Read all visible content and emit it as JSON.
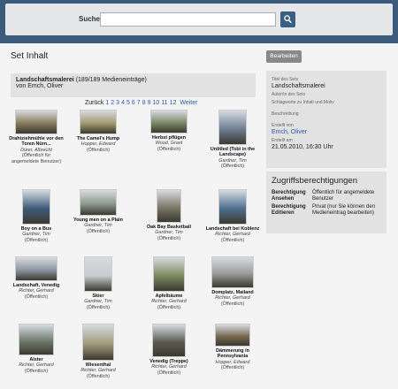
{
  "header": {
    "search_label": "Suche",
    "search_placeholder": "",
    "search_value": ""
  },
  "page": {
    "title": "Set Inhalt",
    "edit_label": "Bearbeiten"
  },
  "set": {
    "name": "Landschaftsmalerei",
    "count": "(189/189 Medieneinträge)",
    "owner_line": "von Emch, Oliver"
  },
  "pager": {
    "back": "Zurück",
    "pages": [
      "1",
      "2",
      "3",
      "4",
      "5",
      "6",
      "7",
      "8",
      "9",
      "10",
      "11",
      "12"
    ],
    "next": "Weiter"
  },
  "items": [
    {
      "title": "Drahtziehmühle vor den Toren Nürn...",
      "author": "Dürer, Albrecht",
      "status": "(Öffentlich für angemeldete Benutzer)"
    },
    {
      "title": "The Camel's Hump",
      "author": "Hopper, Edward",
      "status": "(Öffentlich)"
    },
    {
      "title": "Herbst pflügen",
      "author": "Wood, Grant",
      "status": "(Öffentlich)"
    },
    {
      "title": "Untitled (Tobi in the Landscape)",
      "author": "Gardner, Tim",
      "status": "(Öffentlich)"
    },
    {
      "title": "Boy on a Bus",
      "author": "Gardner, Tim",
      "status": "(Öffentlich)"
    },
    {
      "title": "Young men on a Plain",
      "author": "Gardner, Tim",
      "status": "(Öffentlich)"
    },
    {
      "title": "Oak Bay Basketball",
      "author": "Gardner, Tim",
      "status": "(Öffentlich)"
    },
    {
      "title": "Landschaft bei Koblenz",
      "author": "Richter, Gerhard",
      "status": "(Öffentlich)"
    },
    {
      "title": "Landschaft, Venedig",
      "author": "Richter, Gerhard",
      "status": "(Öffentlich)"
    },
    {
      "title": "Skier",
      "author": "Gardner, Tim",
      "status": "(Öffentlich)"
    },
    {
      "title": "Apfelbäume",
      "author": "Richter, Gerhard",
      "status": "(Öffentlich)"
    },
    {
      "title": "Domplatz, Mailand",
      "author": "Richter, Gerhard",
      "status": "(Öffentlich)"
    },
    {
      "title": "Alster",
      "author": "Richter, Gerhard",
      "status": "(Öffentlich)"
    },
    {
      "title": "Wiesenthal",
      "author": "Richter, Gerhard",
      "status": "(Öffentlich)"
    },
    {
      "title": "Venedig (Treppe)",
      "author": "Richter, Gerhard",
      "status": "(Öffentlich)"
    },
    {
      "title": "Dämmerung in Pennsylvania",
      "author": "Hopper, Edward",
      "status": "(Öffentlich)"
    }
  ],
  "thumb_colors": [
    "#8a7a5c",
    "#a39a72",
    "#7d8a6a",
    "#6f7f93",
    "#3f5a7a",
    "#8c9a8e",
    "#7d7866",
    "#4e6f8f",
    "#8f96a3",
    "#c9ccd0",
    "#7b8a5e",
    "#9a9a9a",
    "#6f7a6e",
    "#a29a7c",
    "#5c5a52",
    "#7a6a52"
  ],
  "sidebar": {
    "title_label": "Titel des Sets",
    "title_value": "Landschaftsmalerei",
    "author_label": "Autor/in des Sets",
    "keywords_label": "Schlagworte zu Inhalt und Motiv",
    "desc_label": "Beschreibung",
    "created_by_label": "Erstellt von",
    "created_by_value": "Emch, Oliver",
    "created_at_label": "Erstellt am",
    "created_at_value": "21.05.2010, 16:30 Uhr"
  },
  "permissions": {
    "title": "Zugriffsberechtigungen",
    "rows": [
      {
        "key": "Berechtigung Ansehen",
        "value": "Öffentlich für angemeldete Benutzer"
      },
      {
        "key": "Berechtigung Editieren",
        "value": "Privat (nur Sie können den Medieneintrag bearbeiten)"
      }
    ]
  }
}
